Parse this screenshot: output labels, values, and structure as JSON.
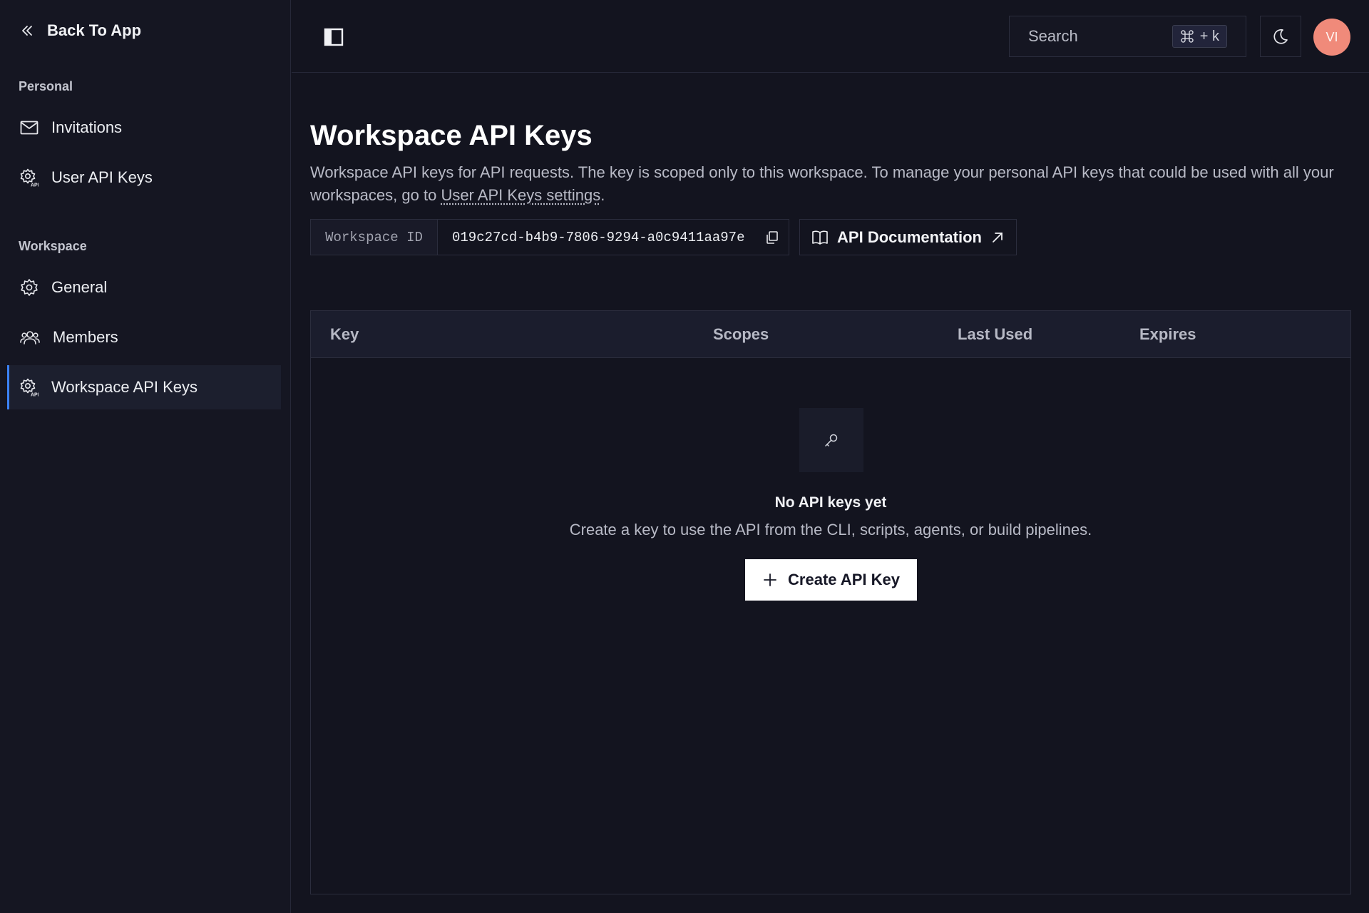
{
  "sidebar": {
    "back_label": "Back To App",
    "sections": [
      {
        "label": "Personal",
        "items": [
          {
            "label": "Invitations",
            "icon": "mail-icon"
          },
          {
            "label": "User API Keys",
            "icon": "api-gear-icon"
          }
        ]
      },
      {
        "label": "Workspace",
        "items": [
          {
            "label": "General",
            "icon": "gear-icon"
          },
          {
            "label": "Members",
            "icon": "users-icon"
          },
          {
            "label": "Workspace API Keys",
            "icon": "api-gear-icon",
            "active": true
          }
        ]
      }
    ]
  },
  "topbar": {
    "search_placeholder": "Search",
    "shortcut": "+ k",
    "avatar_initials": "VI"
  },
  "page": {
    "title": "Workspace API Keys",
    "description_prefix": "Workspace API keys for API requests. The key is scoped only to this workspace. To manage your personal API keys that could be used with all your workspaces, go to ",
    "description_link": "User API Keys settings",
    "description_suffix": ".",
    "workspace_id_label": "Workspace ID",
    "workspace_id_value": "019c27cd-b4b9-7806-9294-a0c9411aa97e",
    "doc_button_label": "API Documentation"
  },
  "table": {
    "columns": [
      "Key",
      "Scopes",
      "Last Used",
      "Expires"
    ],
    "rows": [],
    "empty_title": "No API keys yet",
    "empty_subtitle": "Create a key to use the API from the CLI, scripts, agents, or build pipelines.",
    "create_button_label": "Create API Key"
  },
  "colors": {
    "background": "#13141f",
    "sidebar": "#151622",
    "accent": "#3b82f6",
    "avatar": "#f08a7a"
  }
}
